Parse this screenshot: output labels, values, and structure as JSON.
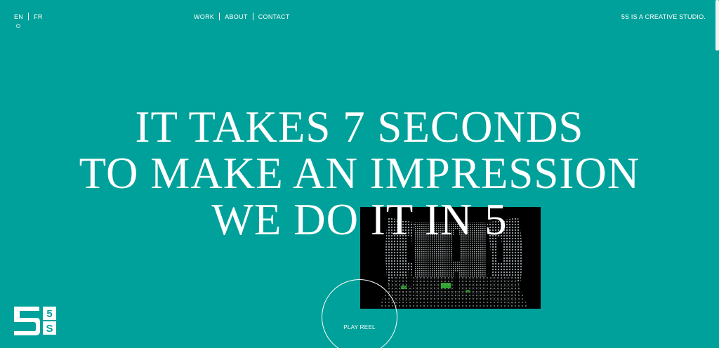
{
  "language": {
    "items": [
      "EN",
      "FR"
    ]
  },
  "nav": {
    "items": [
      "WORK",
      "ABOUT",
      "CONTACT"
    ]
  },
  "tagline": "5S IS A CREATIVE STUDIO.",
  "hero": {
    "lines": [
      "IT TAKES 7 SECONDS",
      "TO MAKE AN IMPRESSION",
      "WE DO IT IN 5"
    ]
  },
  "play_reel_label": "PLAY REEL",
  "logo": {
    "glyphs": [
      "5",
      "S"
    ]
  },
  "colors": {
    "background": "#00a19a",
    "text": "#ffffff",
    "video_bg": "#000000",
    "video_grid": "#9aa4a6",
    "video_accent": "#39c93a"
  },
  "icons": {
    "language_indicator": "circle-dot-icon",
    "logo": "5s-logo-icon"
  }
}
